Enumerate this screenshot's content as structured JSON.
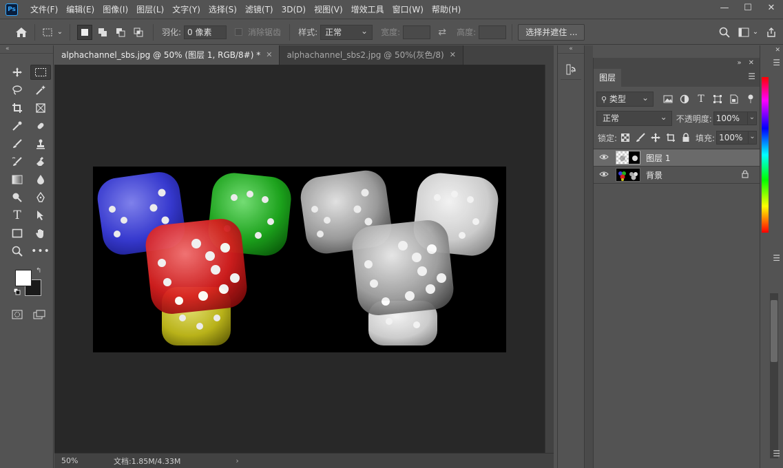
{
  "menu": {
    "logo": "Ps",
    "items": [
      "文件(F)",
      "编辑(E)",
      "图像(I)",
      "图层(L)",
      "文字(Y)",
      "选择(S)",
      "滤镜(T)",
      "3D(D)",
      "视图(V)",
      "增效工具",
      "窗口(W)",
      "帮助(H)"
    ]
  },
  "window_controls": {
    "minimize": "—",
    "maximize": "☐",
    "close": "✕"
  },
  "options": {
    "feather_label": "羽化:",
    "feather_value": "0 像素",
    "antialias_label": "消除锯齿",
    "style_label": "样式:",
    "style_value": "正常",
    "width_label": "宽度:",
    "height_label": "高度:",
    "select_mask_button": "选择并遮住 ..."
  },
  "tabs": [
    {
      "label": "alphachannel_sbs.jpg @ 50% (图层 1, RGB/8#) *",
      "close": "✕"
    },
    {
      "label": "alphachannel_sbs2.jpg @ 50%(灰色/8)",
      "close": "✕"
    }
  ],
  "status": {
    "zoom": "50%",
    "doc_info": "文档:1.85M/4.33M",
    "arrow": "›"
  },
  "colors": {
    "foreground": "#ffffff",
    "background": "#1a1a1a",
    "accent": "#31a8ff"
  },
  "layers_panel": {
    "tab_label": "图层",
    "filter_kind": "类型",
    "blend_mode": "正常",
    "opacity_label": "不透明度:",
    "opacity_value": "100%",
    "lock_label": "锁定:",
    "fill_label": "填充:",
    "fill_value": "100%",
    "layers": [
      {
        "name": "图层 1",
        "visible": true,
        "selected": true,
        "locked": false
      },
      {
        "name": "背景",
        "visible": true,
        "selected": false,
        "locked": true
      }
    ]
  }
}
